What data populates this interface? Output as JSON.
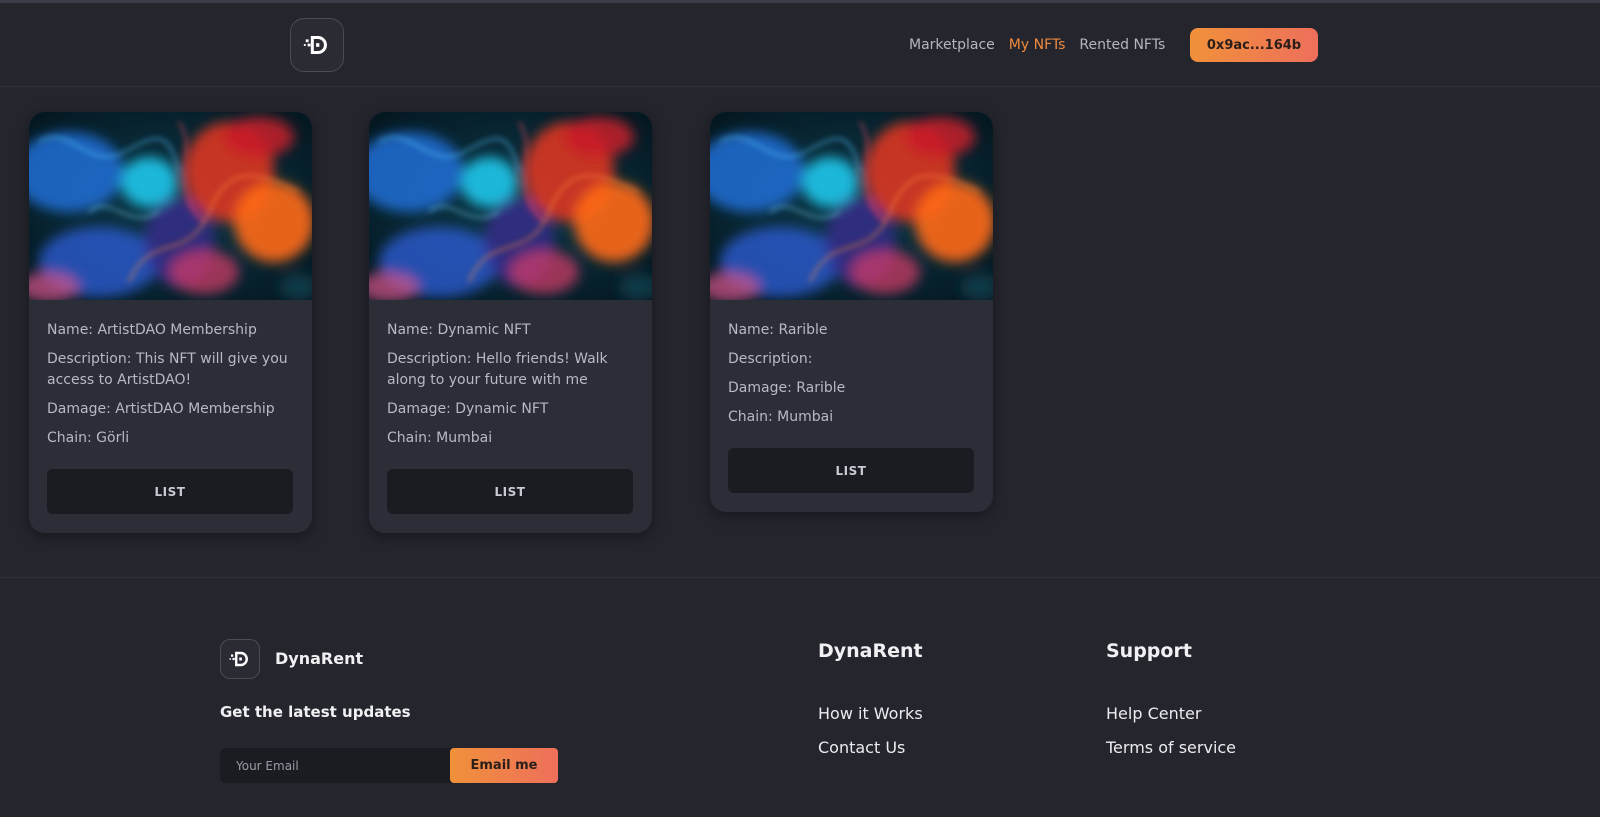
{
  "header": {
    "logo_icon": "dynarent-logo-icon",
    "nav": [
      {
        "label": "Marketplace",
        "active": false
      },
      {
        "label": "My NFTs",
        "active": true
      },
      {
        "label": "Rented NFTs",
        "active": false
      }
    ],
    "wallet_label": "0x9ac...164b",
    "accent_color": "#f08a3c"
  },
  "cards": [
    {
      "name": "Name: ArtistDAO Membership",
      "description": "Description: This NFT will give you access to ArtistDAO!",
      "damage": "Damage: ArtistDAO Membership",
      "chain": "Chain: Görli",
      "button": "LIST"
    },
    {
      "name": "Name: Dynamic NFT",
      "description": "Description: Hello friends! Walk along to your future with me",
      "damage": "Damage: Dynamic NFT",
      "chain": "Chain: Mumbai",
      "button": "LIST"
    },
    {
      "name": "Name: Rarible",
      "description": "Description:",
      "damage": "Damage: Rarible",
      "chain": "Chain: Mumbai",
      "button": "LIST"
    }
  ],
  "footer": {
    "brand": "DynaRent",
    "updates_heading": "Get the latest updates",
    "email_placeholder": "Your Email",
    "email_button": "Email me",
    "columns": [
      {
        "title": "DynaRent",
        "links": [
          "How it Works",
          "Contact Us"
        ]
      },
      {
        "title": "Support",
        "links": [
          "Help Center",
          "Terms of service"
        ]
      }
    ]
  }
}
